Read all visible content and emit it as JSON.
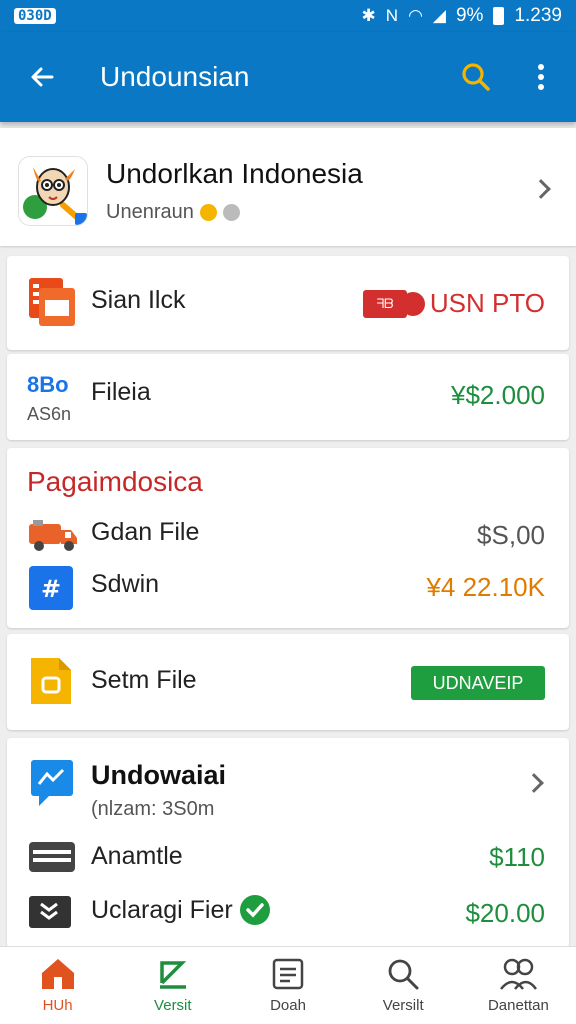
{
  "status_bar": {
    "left_badge": "030D",
    "battery_pct": "9%",
    "time": "1.239"
  },
  "app_bar": {
    "title": "Undounsian",
    "back_icon": "back-arrow-icon",
    "search_icon": "search-icon",
    "more_icon": "more-vert-icon"
  },
  "header": {
    "title": "Undorlkan Indonesia",
    "subtitle": "Unenraun"
  },
  "row_1": {
    "label": "Sian Ilck",
    "tag": "ᖷᗷ",
    "value": "USN PTO"
  },
  "row_2": {
    "icon_top": "8Bo",
    "icon_bottom": "AS6n",
    "label": "Fileia",
    "value": "¥$2.000"
  },
  "section_3": {
    "title": "Pagaimdosica",
    "items": [
      {
        "label": "Gdan File",
        "value": "$S,00",
        "icon": "truck-icon"
      },
      {
        "label": "Sdwin",
        "value": "¥4 22.10K",
        "icon": "hash-icon"
      }
    ]
  },
  "row_4": {
    "label": "Setm File",
    "button": "UDNAVEIP"
  },
  "section_5": {
    "title": "Undowaiai",
    "subtitle": "(nlzam: 3S0m",
    "items": [
      {
        "label": "Anamtle",
        "value": "$110",
        "icon": "card-icon"
      },
      {
        "label": "Uclaragi Fier",
        "value": "$20.00",
        "icon": "chevrons-icon"
      }
    ]
  },
  "bottom_nav": [
    {
      "label": "HUh",
      "icon": "home-icon"
    },
    {
      "label": "Versit",
      "icon": "edit-icon"
    },
    {
      "label": "Doah",
      "icon": "document-icon"
    },
    {
      "label": "Versilt",
      "icon": "search-icon"
    },
    {
      "label": "Danettan",
      "icon": "people-icon"
    }
  ],
  "colors": {
    "primary": "#0a78c4",
    "accent_green": "#1e8e3e",
    "accent_red": "#d32f2f",
    "accent_orange": "#e0531f",
    "accent_amber": "#e07b00"
  }
}
